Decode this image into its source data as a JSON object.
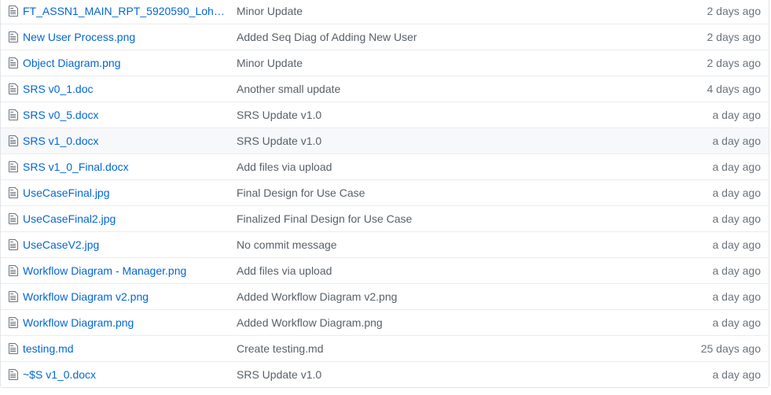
{
  "files": [
    {
      "name": "FT_ASSN1_MAIN_RPT_5920590_LohHa...",
      "message": "Minor Update",
      "age": "2 days ago",
      "icon": "file-icon"
    },
    {
      "name": "New User Process.png",
      "message": "Added Seq Diag of Adding New User",
      "age": "2 days ago",
      "icon": "file-icon"
    },
    {
      "name": "Object Diagram.png",
      "message": "Minor Update",
      "age": "2 days ago",
      "icon": "file-icon"
    },
    {
      "name": "SRS v0_1.doc",
      "message": "Another small update",
      "age": "4 days ago",
      "icon": "file-icon"
    },
    {
      "name": "SRS v0_5.docx",
      "message": "SRS Update v1.0",
      "age": "a day ago",
      "icon": "file-icon"
    },
    {
      "name": "SRS v1_0.docx",
      "message": "SRS Update v1.0",
      "age": "a day ago",
      "icon": "file-icon",
      "hovered": true
    },
    {
      "name": "SRS v1_0_Final.docx",
      "message": "Add files via upload",
      "age": "a day ago",
      "icon": "file-icon"
    },
    {
      "name": "UseCaseFinal.jpg",
      "message": "Final Design for Use Case",
      "age": "a day ago",
      "icon": "file-icon"
    },
    {
      "name": "UseCaseFinal2.jpg",
      "message": "Finalized Final Design for Use Case",
      "age": "a day ago",
      "icon": "file-icon"
    },
    {
      "name": "UseCaseV2.jpg",
      "message": "No commit message",
      "age": "a day ago",
      "icon": "file-icon"
    },
    {
      "name": "Workflow Diagram - Manager.png",
      "message": "Add files via upload",
      "age": "a day ago",
      "icon": "file-icon"
    },
    {
      "name": "Workflow Diagram v2.png",
      "message": "Added Workflow Diagram v2.png",
      "age": "a day ago",
      "icon": "file-icon"
    },
    {
      "name": "Workflow Diagram.png",
      "message": "Added Workflow Diagram.png",
      "age": "a day ago",
      "icon": "file-icon"
    },
    {
      "name": "testing.md",
      "message": "Create testing.md",
      "age": "25 days ago",
      "icon": "file-icon"
    },
    {
      "name": "~$S v1_0.docx",
      "message": "SRS Update v1.0",
      "age": "a day ago",
      "icon": "file-icon"
    }
  ],
  "colors": {
    "link": "#0366d6",
    "message": "#586069",
    "age": "#6a737d",
    "icon": "#6a737d",
    "hover_row": "#f6f8fa",
    "border": "#eaecef"
  }
}
